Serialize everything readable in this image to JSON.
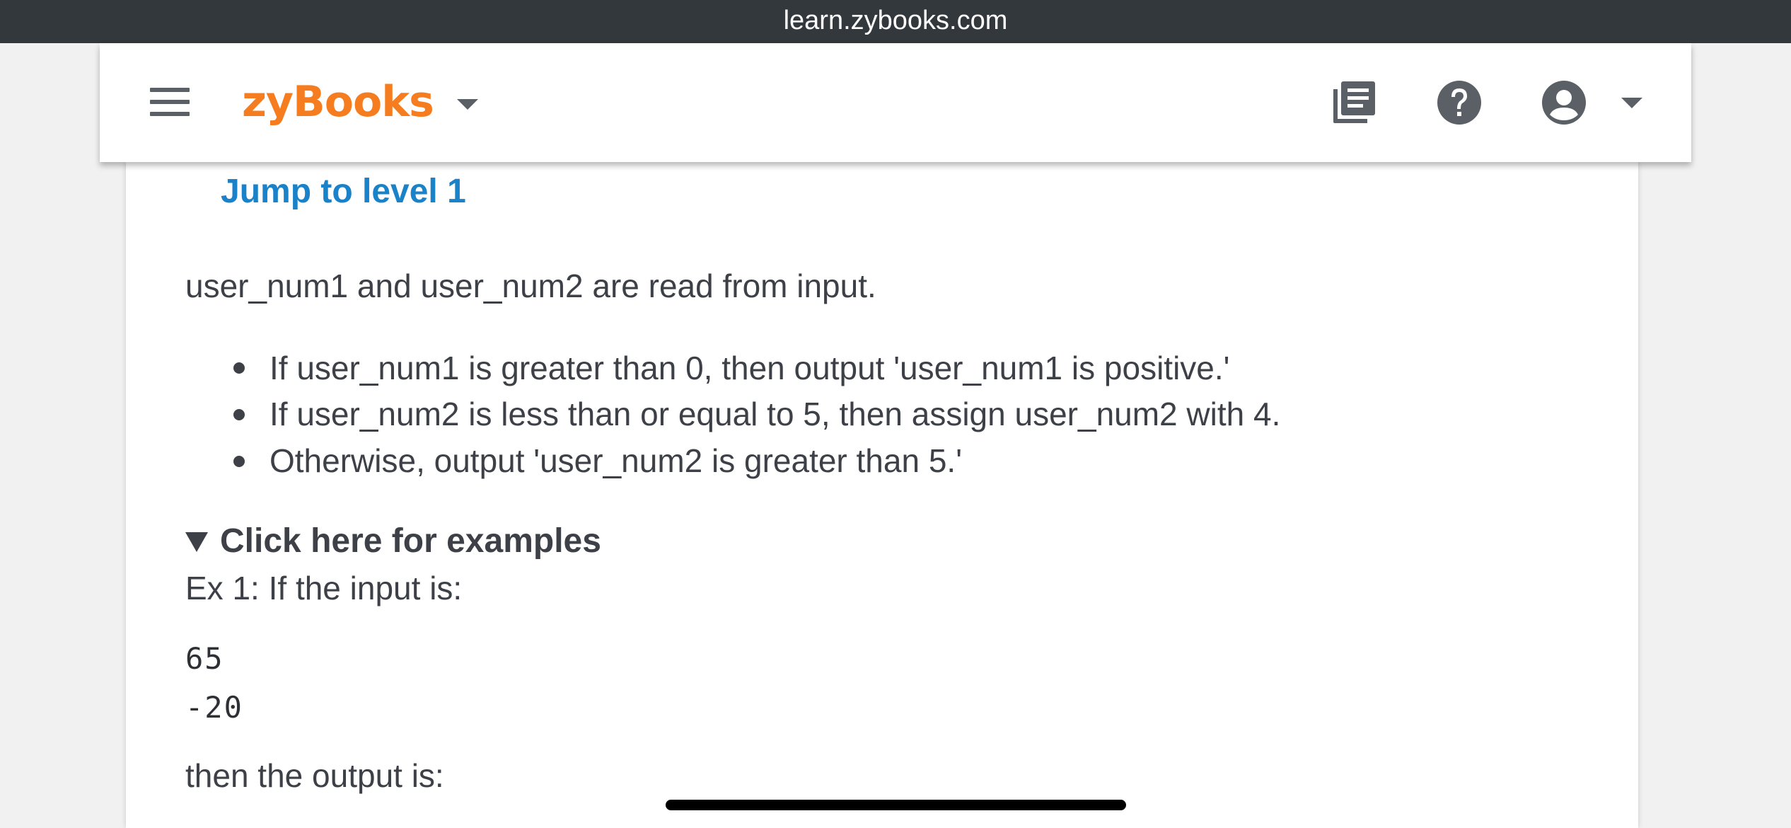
{
  "browser": {
    "url": "learn.zybooks.com"
  },
  "header": {
    "logo_text": "zyBooks",
    "brand_color": "#f57d1f",
    "icons": [
      "menu-icon",
      "chevron-down-icon",
      "library-icon",
      "help-icon",
      "account-icon",
      "chevron-down-icon"
    ]
  },
  "content": {
    "jump_link": "Jump to level 1",
    "intro": "user_num1 and user_num2 are read from input.",
    "bullets": [
      "If user_num1 is greater than 0, then output 'user_num1 is positive.'",
      "If user_num2 is less than or equal to 5, then assign user_num2 with 4.",
      "Otherwise, output 'user_num2 is greater than 5.'"
    ],
    "examples_toggle": "Click here for examples",
    "example_intro": "Ex 1: If the input is:",
    "example_input": [
      "65",
      "-20"
    ],
    "output_intro": "then the output is:"
  },
  "colors": {
    "url_bar": "#33383d",
    "link": "#1a82c8",
    "text": "#3d4147",
    "icon_gray": "#5a6066"
  }
}
